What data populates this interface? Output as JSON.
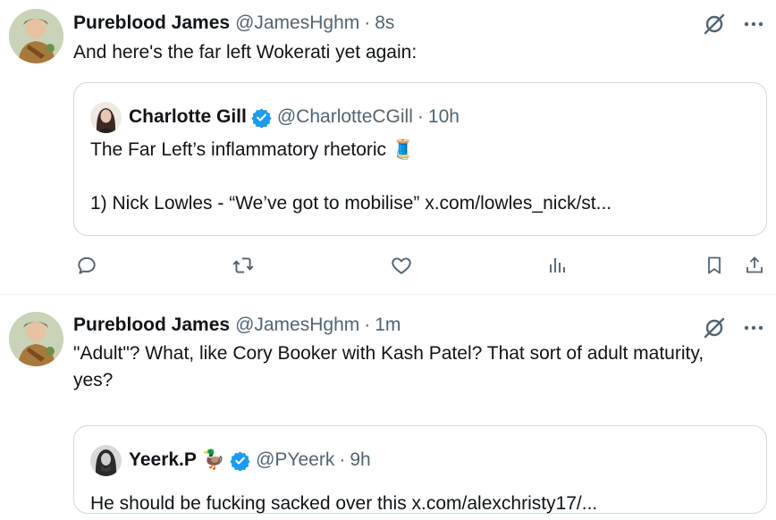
{
  "tweets": [
    {
      "author_name": "Pureblood James",
      "author_handle": "@JamesHghm",
      "separator": "·",
      "time": "8s",
      "text": "And here's the far left Wokerati yet again:",
      "quote": {
        "author_name": "Charlotte Gill",
        "author_handle": "@CharlotteCGill",
        "separator": "·",
        "time": "10h",
        "line1": "The Far Left’s inflammatory rhetoric 🧵",
        "line2": "1) Nick Lowles - “We’ve got to mobilise” x.com/lowles_nick/st..."
      }
    },
    {
      "author_name": "Pureblood James",
      "author_handle": "@JamesHghm",
      "separator": "·",
      "time": "1m",
      "text": "\"Adult\"?  What, like Cory Booker with Kash Patel?  That sort of adult maturity, yes?",
      "quote": {
        "author_name": "Yeerk.P",
        "author_emoji": "🦆",
        "author_handle": "@PYeerk",
        "separator": "·",
        "time": "9h",
        "line1": "He should be fucking sacked over this x.com/alexchristy17/..."
      }
    }
  ],
  "icons": {
    "grok": "grok-icon",
    "more": "more-icon",
    "reply": "reply-icon",
    "retweet": "retweet-icon",
    "like": "like-icon",
    "views": "views-icon",
    "bookmark": "bookmark-icon",
    "share": "share-icon",
    "verified": "verified-badge-icon"
  },
  "colors": {
    "text": "#0f1419",
    "secondary": "#536471",
    "verified": "#1d9bf0",
    "border": "#cfd9de"
  }
}
